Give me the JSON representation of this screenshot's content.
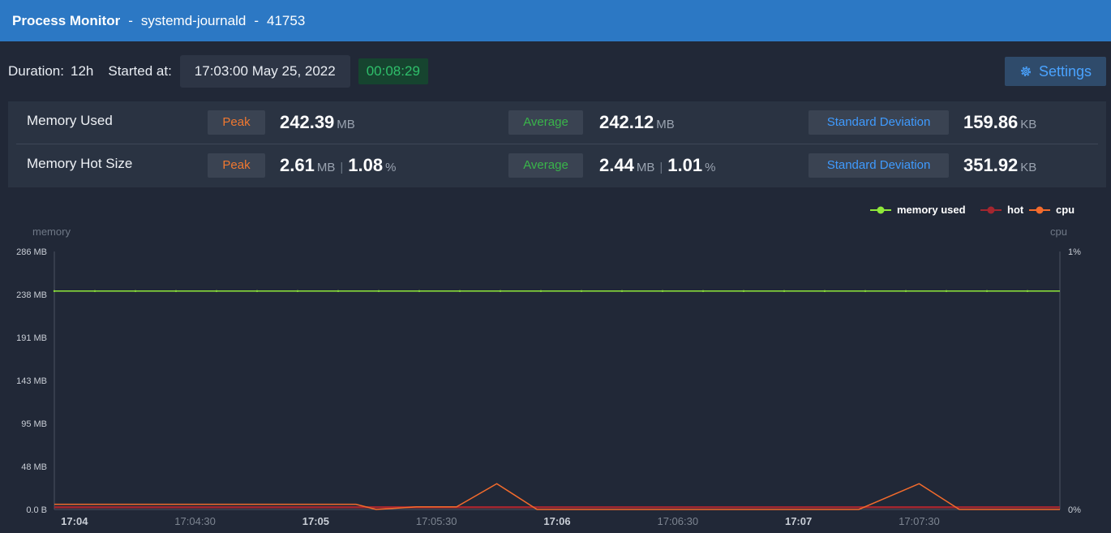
{
  "header": {
    "app_title": "Process Monitor",
    "separator": "-",
    "process_name": "systemd-journald",
    "pid": "41753"
  },
  "info": {
    "duration_label": "Duration:",
    "duration_value": "12h",
    "started_label": "Started at:",
    "started_value": "17:03:00 May 25, 2022",
    "elapsed": "00:08:29",
    "settings_label": "Settings"
  },
  "stats": {
    "rows": [
      {
        "label": "Memory Used",
        "peak_label": "Peak",
        "peak_value": "242.39",
        "peak_unit": "MB",
        "avg_label": "Average",
        "avg_value": "242.12",
        "avg_unit": "MB",
        "std_label": "Standard Deviation",
        "std_value": "159.86",
        "std_unit": "KB"
      },
      {
        "label": "Memory Hot Size",
        "peak_label": "Peak",
        "peak_value": "2.61",
        "peak_unit": "MB",
        "peak_pct": "1.08",
        "pct_unit": "%",
        "avg_label": "Average",
        "avg_value": "2.44",
        "avg_unit": "MB",
        "avg_pct": "1.01",
        "std_label": "Standard Deviation",
        "std_value": "351.92",
        "std_unit": "KB"
      }
    ]
  },
  "colors": {
    "memory_used": "#8fe83a",
    "hot": "#a3262f",
    "cpu": "#f36b2c",
    "accent": "#2c78c4"
  },
  "chart_data": {
    "type": "line",
    "legend_position": "top-right",
    "left_axis_label": "memory",
    "right_axis_label": "cpu",
    "y_ticks": [
      "0.0 B",
      "48 MB",
      "95 MB",
      "143 MB",
      "191 MB",
      "238 MB",
      "286 MB"
    ],
    "y_range_mb": [
      0,
      286
    ],
    "y2_ticks": [
      "0%",
      "1%"
    ],
    "y2_range_pct": [
      0,
      1
    ],
    "x_ticks": [
      {
        "label": "17:04",
        "major": true
      },
      {
        "label": "17:04:30",
        "major": false
      },
      {
        "label": "17:05",
        "major": true
      },
      {
        "label": "17:05:30",
        "major": false
      },
      {
        "label": "17:06",
        "major": true
      },
      {
        "label": "17:06:30",
        "major": false
      },
      {
        "label": "17:07",
        "major": true
      },
      {
        "label": "17:07:30",
        "major": false
      }
    ],
    "x_range": [
      "17:03:55",
      "17:08:05"
    ],
    "series": [
      {
        "name": "memory used",
        "axis": "left",
        "points": [
          [
            "17:03:55",
            242.1
          ],
          [
            "17:08:05",
            242.1
          ]
        ]
      },
      {
        "name": "hot",
        "axis": "left",
        "points": [
          [
            "17:03:55",
            2.4
          ],
          [
            "17:08:05",
            2.4
          ]
        ]
      },
      {
        "name": "cpu",
        "axis": "right",
        "points": [
          [
            "17:03:55",
            0.02
          ],
          [
            "17:05:10",
            0.02
          ],
          [
            "17:05:15",
            0.0
          ],
          [
            "17:05:25",
            0.01
          ],
          [
            "17:05:35",
            0.01
          ],
          [
            "17:05:45",
            0.1
          ],
          [
            "17:05:55",
            0.0
          ],
          [
            "17:07:15",
            0.0
          ],
          [
            "17:07:30",
            0.1
          ],
          [
            "17:07:40",
            0.0
          ],
          [
            "17:08:05",
            0.0
          ]
        ]
      }
    ]
  }
}
